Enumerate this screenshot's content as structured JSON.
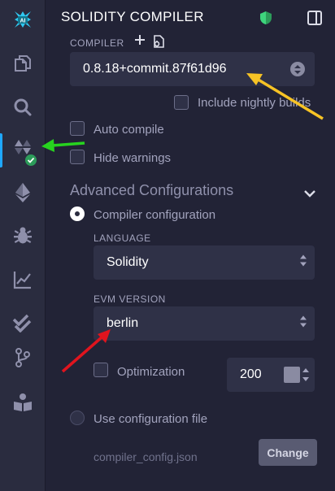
{
  "sidebar": {
    "icons": [
      "logo-icon",
      "file-explorer-icon",
      "search-icon",
      "solidity-compiler-icon",
      "deploy-run-icon",
      "debugger-icon",
      "analytics-icon",
      "unit-testing-icon",
      "git-icon",
      "learneth-icon"
    ],
    "active": "solidity-compiler-icon"
  },
  "header": {
    "title": "SOLIDITY COMPILER"
  },
  "compiler": {
    "label": "COMPILER",
    "version": "0.8.18+commit.87f61d96",
    "include_nightly_label": "Include nightly builds"
  },
  "options": {
    "auto_compile_label": "Auto compile",
    "hide_warnings_label": "Hide warnings"
  },
  "advanced": {
    "title": "Advanced Configurations",
    "compiler_config_label": "Compiler configuration",
    "language_label": "LANGUAGE",
    "language_value": "Solidity",
    "evm_label": "EVM VERSION",
    "evm_value": "berlin",
    "optimization_label": "Optimization",
    "runs_value": "200",
    "use_config_file_label": "Use configuration file",
    "config_file_name": "compiler_config.json",
    "change_button": "Change"
  },
  "colors": {
    "accent": "#1fa8ff",
    "success": "#2c9c5a",
    "annotation_yellow": "#f7c325",
    "annotation_green": "#27d31f",
    "annotation_red": "#e0141e"
  }
}
